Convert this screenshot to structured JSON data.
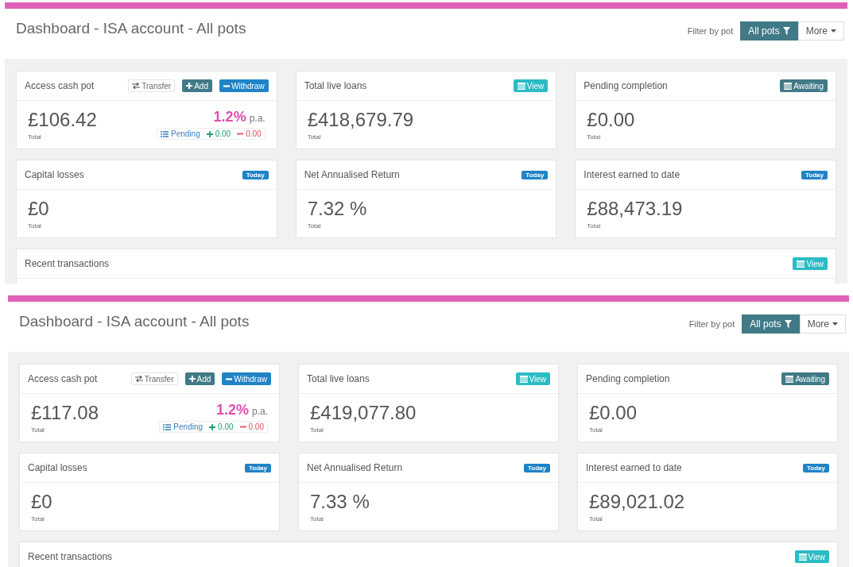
{
  "snapshots": [
    {
      "title": "Dashboard - ISA account - All pots",
      "filter": {
        "label": "Filter by pot",
        "buttons": [
          {
            "label": "All pots",
            "selected": true,
            "kind": "filter"
          },
          {
            "label": "More",
            "selected": false,
            "kind": "dropdown"
          }
        ]
      },
      "cards": [
        {
          "title": "Access cash pot",
          "actions": [
            {
              "kind": "transfer",
              "label": "Transfer"
            },
            {
              "kind": "add",
              "label": "Add"
            },
            {
              "kind": "withdraw",
              "label": "Withdraw"
            }
          ],
          "value": "£106.42",
          "caption": "Total",
          "rate": {
            "value": "1.2%",
            "unit": "p.a.",
            "pending": "Pending",
            "plus": "0.00",
            "minus": "0.00"
          }
        },
        {
          "title": "Total live loans",
          "actions": [
            {
              "kind": "view",
              "label": "View"
            }
          ],
          "value": "£418,679.79",
          "caption": "Total"
        },
        {
          "title": "Pending completion",
          "actions": [
            {
              "kind": "awaiting",
              "label": "Awaiting"
            }
          ],
          "value": "£0.00",
          "caption": "Total"
        },
        {
          "title": "Capital losses",
          "actions": [
            {
              "kind": "today",
              "label": "Today"
            }
          ],
          "value": "£0",
          "caption": "Total"
        },
        {
          "title": "Net Annualised Return",
          "actions": [
            {
              "kind": "today",
              "label": "Today"
            }
          ],
          "value": "7.32 %",
          "caption": "Total"
        },
        {
          "title": "Interest earned to date",
          "actions": [
            {
              "kind": "today",
              "label": "Today"
            }
          ],
          "value": "£88,473.19",
          "caption": "Total"
        }
      ],
      "recent": {
        "title": "Recent transactions",
        "actions": [
          {
            "kind": "view",
            "label": "View"
          }
        ]
      }
    },
    {
      "title": "Dashboard - ISA account - All pots",
      "filter": {
        "label": "Filter by pot",
        "buttons": [
          {
            "label": "All pots",
            "selected": true,
            "kind": "filter"
          },
          {
            "label": "More",
            "selected": false,
            "kind": "dropdown"
          }
        ]
      },
      "cards": [
        {
          "title": "Access cash pot",
          "actions": [
            {
              "kind": "transfer",
              "label": "Transfer"
            },
            {
              "kind": "add",
              "label": "Add"
            },
            {
              "kind": "withdraw",
              "label": "Withdraw"
            }
          ],
          "value": "£117.08",
          "caption": "Total",
          "rate": {
            "value": "1.2%",
            "unit": "p.a.",
            "pending": "Pending",
            "plus": "0.00",
            "minus": "0.00"
          }
        },
        {
          "title": "Total live loans",
          "actions": [
            {
              "kind": "view",
              "label": "View"
            }
          ],
          "value": "£419,077.80",
          "caption": "Total"
        },
        {
          "title": "Pending completion",
          "actions": [
            {
              "kind": "awaiting",
              "label": "Awaiting"
            }
          ],
          "value": "£0.00",
          "caption": "Total"
        },
        {
          "title": "Capital losses",
          "actions": [
            {
              "kind": "today",
              "label": "Today"
            }
          ],
          "value": "£0",
          "caption": "Total"
        },
        {
          "title": "Net Annualised Return",
          "actions": [
            {
              "kind": "today",
              "label": "Today"
            }
          ],
          "value": "7.33 %",
          "caption": "Total"
        },
        {
          "title": "Interest earned to date",
          "actions": [
            {
              "kind": "today",
              "label": "Today"
            }
          ],
          "value": "£89,021.02",
          "caption": "Total"
        }
      ],
      "recent": {
        "title": "Recent transactions",
        "actions": [
          {
            "kind": "view",
            "label": "View"
          }
        ]
      }
    }
  ]
}
